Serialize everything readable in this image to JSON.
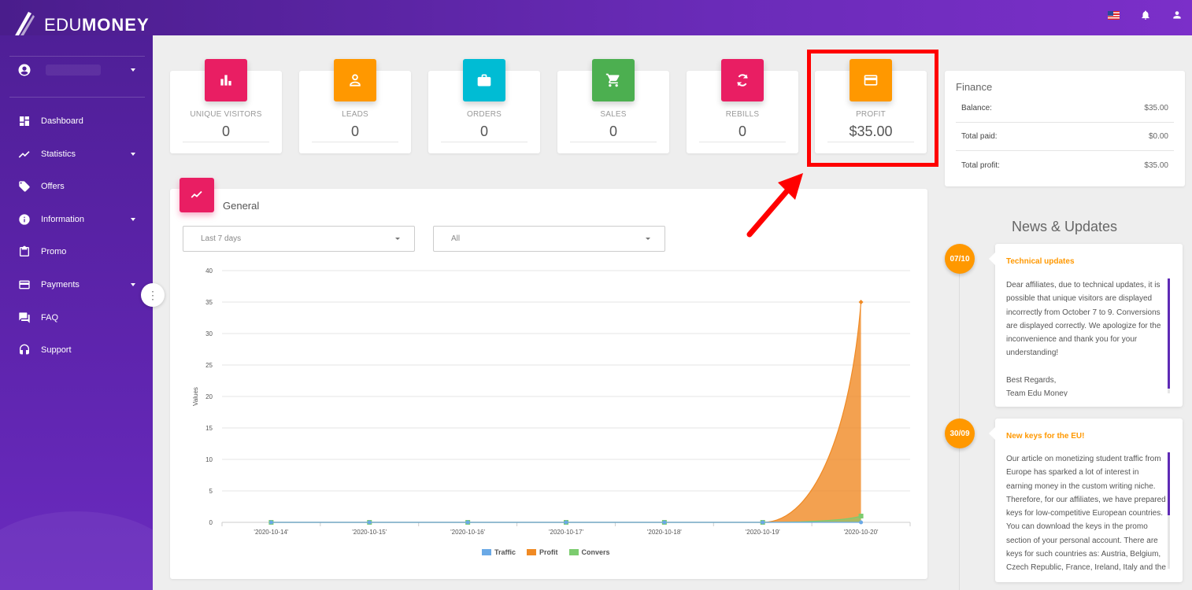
{
  "header": {
    "logo_light": "EDU",
    "logo_bold": "MONEY"
  },
  "sidebar": {
    "items": [
      {
        "label": "Dashboard",
        "icon": "dashboard-icon",
        "active": true,
        "has_submenu": false
      },
      {
        "label": "Statistics",
        "icon": "trending-up-icon",
        "active": false,
        "has_submenu": true
      },
      {
        "label": "Offers",
        "icon": "tag-icon",
        "active": false,
        "has_submenu": false
      },
      {
        "label": "Information",
        "icon": "info-icon",
        "active": false,
        "has_submenu": true
      },
      {
        "label": "Promo",
        "icon": "clipboard-icon",
        "active": false,
        "has_submenu": false
      },
      {
        "label": "Payments",
        "icon": "credit-card-icon",
        "active": false,
        "has_submenu": true
      },
      {
        "label": "FAQ",
        "icon": "forum-icon",
        "active": false,
        "has_submenu": false
      },
      {
        "label": "Support",
        "icon": "headset-icon",
        "active": false,
        "has_submenu": false
      }
    ]
  },
  "stats": [
    {
      "label": "UNIQUE VISITORS",
      "value": "0",
      "color": "#e91e63",
      "icon": "bar-chart-icon"
    },
    {
      "label": "LEADS",
      "value": "0",
      "color": "#ff9800",
      "icon": "person-icon"
    },
    {
      "label": "ORDERS",
      "value": "0",
      "color": "#00bcd4",
      "icon": "briefcase-icon"
    },
    {
      "label": "SALES",
      "value": "0",
      "color": "#4caf50",
      "icon": "cart-icon"
    },
    {
      "label": "REBILLS",
      "value": "0",
      "color": "#e91e63",
      "icon": "refresh-icon"
    },
    {
      "label": "PROFIT",
      "value": "$35.00",
      "color": "#ff9800",
      "icon": "credit-card-icon"
    }
  ],
  "finance": {
    "title": "Finance",
    "rows": [
      {
        "label": "Balance:",
        "value": "$35.00"
      },
      {
        "label": "Total paid:",
        "value": "$0.00"
      },
      {
        "label": "Total profit:",
        "value": "$35.00"
      }
    ]
  },
  "general": {
    "title": "General",
    "period_select": "Last 7 days",
    "filter_select": "All"
  },
  "news": {
    "title": "News & Updates",
    "items": [
      {
        "date": "07/10",
        "title": "Technical updates",
        "lines": [
          "Dear affiliates, due to technical updates, it is",
          "possible that unique visitors are displayed",
          "incorrectly from October 7 to 9. Conversions",
          "are displayed correctly. We apologize for the",
          "inconvenience and thank you for your",
          "understanding!",
          "",
          "Best Regards,",
          "Team Edu Money"
        ]
      },
      {
        "date": "30/09",
        "title": "New keys for the EU!",
        "lines": [
          "Our article on monetizing student traffic from",
          "Europe has sparked a lot of interest in",
          "earning money in the custom writing niche.",
          "Therefore, for our affiliates, we have prepared",
          "keys for low-competitive European countries.",
          "You can download the keys in the promo",
          "section of your personal account. There are",
          "keys for such countries as: Austria, Belgium,",
          "Czech Republic, France, Ireland, Italy and the"
        ]
      }
    ]
  },
  "colors": {
    "accent_pink": "#e91e63",
    "accent_orange": "#ff9800",
    "sidebar_purple": "#5e24ad",
    "highlight_red": "#ff0000"
  },
  "chart_data": {
    "type": "area",
    "categories": [
      "'2020-10-14'",
      "'2020-10-15'",
      "'2020-10-16'",
      "'2020-10-17'",
      "'2020-10-18'",
      "'2020-10-19'",
      "'2020-10-20'"
    ],
    "series": [
      {
        "name": "Traffic",
        "color": "#6aa9e6",
        "values": [
          0,
          0,
          0,
          0,
          0,
          0,
          0
        ]
      },
      {
        "name": "Profit",
        "color": "#f08a24",
        "values": [
          0,
          0,
          0,
          0,
          0,
          0,
          35
        ]
      },
      {
        "name": "Convers",
        "color": "#7ccc6f",
        "values": [
          0,
          0,
          0,
          0,
          0,
          0,
          1
        ]
      }
    ],
    "ylabel": "Values",
    "xlabel": "",
    "ylim": [
      0,
      40
    ],
    "yticks": [
      0,
      5,
      10,
      15,
      20,
      25,
      30,
      35,
      40
    ],
    "grid": true,
    "legend": "bottom-center"
  }
}
